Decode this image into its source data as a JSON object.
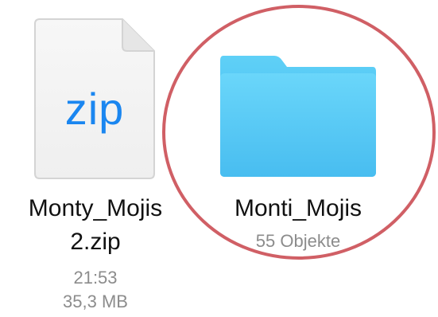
{
  "files": [
    {
      "type": "zip",
      "icon": "zip-file-icon",
      "icon_label": "zip",
      "name_line1": "Monty_Mojis",
      "name_line2": "2.zip",
      "time": "21:53",
      "size": "35,3 MB"
    },
    {
      "type": "folder",
      "icon": "folder-icon",
      "name": "Monti_Mojis",
      "item_count": "55 Objekte"
    }
  ],
  "colors": {
    "zip_accent": "#1a86f0",
    "folder_blue": "#4fc3f2",
    "annotation_red": "#c8434a",
    "meta_gray": "#8c8c8c"
  }
}
